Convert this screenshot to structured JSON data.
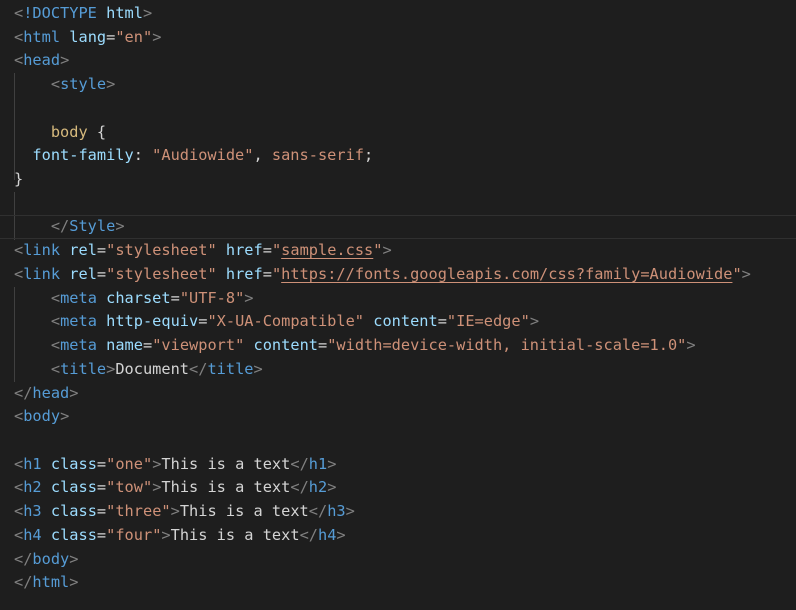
{
  "editor": {
    "language": "html",
    "colors": {
      "background": "#1e1e1e",
      "punctuation": "#808080",
      "tag": "#569cd6",
      "attribute": "#9cdcfe",
      "string": "#ce9178",
      "selector": "#d7ba7d",
      "text": "#d4d4d4"
    },
    "current_line": 9,
    "lines": [
      [
        [
          "p",
          "<"
        ],
        [
          "tag",
          "!DOCTYPE"
        ],
        [
          "text",
          " "
        ],
        [
          "attr",
          "html"
        ],
        [
          "p",
          ">"
        ]
      ],
      [
        [
          "p",
          "<"
        ],
        [
          "tag",
          "html"
        ],
        [
          "text",
          " "
        ],
        [
          "attr",
          "lang"
        ],
        [
          "text",
          "="
        ],
        [
          "str",
          "\"en\""
        ],
        [
          "p",
          ">"
        ]
      ],
      [
        [
          "p",
          "<"
        ],
        [
          "tag",
          "head"
        ],
        [
          "p",
          ">"
        ]
      ],
      [
        [
          "text",
          "    "
        ],
        [
          "p",
          "<"
        ],
        [
          "tag",
          "style"
        ],
        [
          "p",
          ">"
        ]
      ],
      [],
      [
        [
          "text",
          "    "
        ],
        [
          "sel",
          "body"
        ],
        [
          "text",
          " {"
        ]
      ],
      [
        [
          "text",
          "  "
        ],
        [
          "prop",
          "font-family"
        ],
        [
          "text",
          ": "
        ],
        [
          "str",
          "\"Audiowide\""
        ],
        [
          "text",
          ", "
        ],
        [
          "str",
          "sans-serif"
        ],
        [
          "text",
          ";"
        ]
      ],
      [
        [
          "text",
          "}"
        ]
      ],
      [],
      [
        [
          "text",
          "    "
        ],
        [
          "p",
          "</"
        ],
        [
          "tag",
          "Style"
        ],
        [
          "p",
          ">"
        ]
      ],
      [
        [
          "p",
          "<"
        ],
        [
          "tag",
          "link"
        ],
        [
          "text",
          " "
        ],
        [
          "attr",
          "rel"
        ],
        [
          "text",
          "="
        ],
        [
          "str",
          "\"stylesheet\""
        ],
        [
          "text",
          " "
        ],
        [
          "attr",
          "href"
        ],
        [
          "text",
          "="
        ],
        [
          "str",
          "\""
        ],
        [
          "link",
          "sample.css"
        ],
        [
          "str",
          "\""
        ],
        [
          "p",
          ">"
        ]
      ],
      [
        [
          "p",
          "<"
        ],
        [
          "tag",
          "link"
        ],
        [
          "text",
          " "
        ],
        [
          "attr",
          "rel"
        ],
        [
          "text",
          "="
        ],
        [
          "str",
          "\"stylesheet\""
        ],
        [
          "text",
          " "
        ],
        [
          "attr",
          "href"
        ],
        [
          "text",
          "="
        ],
        [
          "str",
          "\""
        ],
        [
          "link",
          "https://fonts.googleapis.com/css?family=Audiowide"
        ],
        [
          "str",
          "\""
        ],
        [
          "p",
          ">"
        ]
      ],
      [
        [
          "text",
          "    "
        ],
        [
          "p",
          "<"
        ],
        [
          "tag",
          "meta"
        ],
        [
          "text",
          " "
        ],
        [
          "attr",
          "charset"
        ],
        [
          "text",
          "="
        ],
        [
          "str",
          "\"UTF-8\""
        ],
        [
          "p",
          ">"
        ]
      ],
      [
        [
          "text",
          "    "
        ],
        [
          "p",
          "<"
        ],
        [
          "tag",
          "meta"
        ],
        [
          "text",
          " "
        ],
        [
          "attr",
          "http-equiv"
        ],
        [
          "text",
          "="
        ],
        [
          "str",
          "\"X-UA-Compatible\""
        ],
        [
          "text",
          " "
        ],
        [
          "attr",
          "content"
        ],
        [
          "text",
          "="
        ],
        [
          "str",
          "\"IE=edge\""
        ],
        [
          "p",
          ">"
        ]
      ],
      [
        [
          "text",
          "    "
        ],
        [
          "p",
          "<"
        ],
        [
          "tag",
          "meta"
        ],
        [
          "text",
          " "
        ],
        [
          "attr",
          "name"
        ],
        [
          "text",
          "="
        ],
        [
          "str",
          "\"viewport\""
        ],
        [
          "text",
          " "
        ],
        [
          "attr",
          "content"
        ],
        [
          "text",
          "="
        ],
        [
          "str",
          "\"width=device-width, initial-scale=1.0\""
        ],
        [
          "p",
          ">"
        ]
      ],
      [
        [
          "text",
          "    "
        ],
        [
          "p",
          "<"
        ],
        [
          "tag",
          "title"
        ],
        [
          "p",
          ">"
        ],
        [
          "text",
          "Document"
        ],
        [
          "p",
          "</"
        ],
        [
          "tag",
          "title"
        ],
        [
          "p",
          ">"
        ]
      ],
      [
        [
          "p",
          "</"
        ],
        [
          "tag",
          "head"
        ],
        [
          "p",
          ">"
        ]
      ],
      [
        [
          "p",
          "<"
        ],
        [
          "tag",
          "body"
        ],
        [
          "p",
          ">"
        ]
      ],
      [],
      [
        [
          "p",
          "<"
        ],
        [
          "tag",
          "h1"
        ],
        [
          "text",
          " "
        ],
        [
          "attr",
          "class"
        ],
        [
          "text",
          "="
        ],
        [
          "str",
          "\"one\""
        ],
        [
          "p",
          ">"
        ],
        [
          "text",
          "This is a text"
        ],
        [
          "p",
          "</"
        ],
        [
          "tag",
          "h1"
        ],
        [
          "p",
          ">"
        ]
      ],
      [
        [
          "p",
          "<"
        ],
        [
          "tag",
          "h2"
        ],
        [
          "text",
          " "
        ],
        [
          "attr",
          "class"
        ],
        [
          "text",
          "="
        ],
        [
          "str",
          "\"tow\""
        ],
        [
          "p",
          ">"
        ],
        [
          "text",
          "This is a text"
        ],
        [
          "p",
          "</"
        ],
        [
          "tag",
          "h2"
        ],
        [
          "p",
          ">"
        ]
      ],
      [
        [
          "p",
          "<"
        ],
        [
          "tag",
          "h3"
        ],
        [
          "text",
          " "
        ],
        [
          "attr",
          "class"
        ],
        [
          "text",
          "="
        ],
        [
          "str",
          "\"three\""
        ],
        [
          "p",
          ">"
        ],
        [
          "text",
          "This is a text"
        ],
        [
          "p",
          "</"
        ],
        [
          "tag",
          "h3"
        ],
        [
          "p",
          ">"
        ]
      ],
      [
        [
          "p",
          "<"
        ],
        [
          "tag",
          "h4"
        ],
        [
          "text",
          " "
        ],
        [
          "attr",
          "class"
        ],
        [
          "text",
          "="
        ],
        [
          "str",
          "\"four\""
        ],
        [
          "p",
          ">"
        ],
        [
          "text",
          "This is a text"
        ],
        [
          "p",
          "</"
        ],
        [
          "tag",
          "h4"
        ],
        [
          "p",
          ">"
        ]
      ],
      [
        [
          "p",
          "</"
        ],
        [
          "tag",
          "body"
        ],
        [
          "p",
          ">"
        ]
      ],
      [
        [
          "p",
          "</"
        ],
        [
          "tag",
          "html"
        ],
        [
          "p",
          ">"
        ]
      ]
    ]
  }
}
